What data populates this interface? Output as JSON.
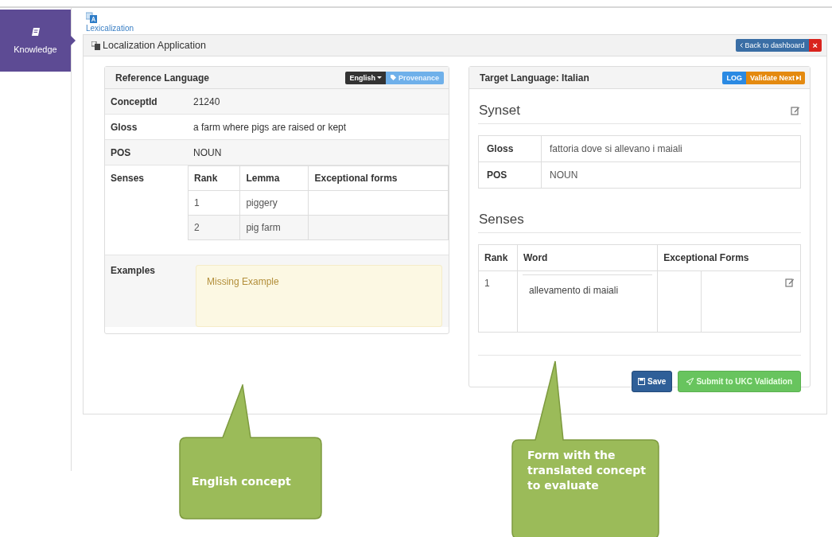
{
  "sidebar": {
    "items": [
      {
        "label": "Knowledge",
        "selected": true
      }
    ]
  },
  "app": {
    "label": "Lexicalization"
  },
  "panel": {
    "title": "Localization Application",
    "back_button": "Back to dashboard",
    "close_button": "×"
  },
  "reference": {
    "title": "Reference Language",
    "language_button": "English",
    "provenance_button": "Provenance",
    "fields": [
      {
        "label": "ConceptId",
        "value": "21240"
      },
      {
        "label": "Gloss",
        "value": "a farm where pigs are raised or kept"
      },
      {
        "label": "POS",
        "value": "NOUN"
      }
    ],
    "senses": {
      "label": "Senses",
      "columns": [
        "Rank",
        "Lemma",
        "Exceptional forms"
      ],
      "rows": [
        [
          "1",
          "piggery",
          ""
        ],
        [
          "2",
          "pig farm",
          ""
        ]
      ]
    },
    "examples": {
      "label": "Examples",
      "message": "Missing Example"
    }
  },
  "target": {
    "title": "Target Language: Italian",
    "log_button": "LOG",
    "validate_button": "Validate Next",
    "synset_heading": "Synset",
    "fields": [
      {
        "label": "Gloss",
        "value": "fattoria dove si allevano i maiali"
      },
      {
        "label": "POS",
        "value": "NOUN"
      }
    ],
    "senses_heading": "Senses",
    "senses": {
      "columns": [
        "Rank",
        "Word",
        "Exceptional Forms"
      ],
      "rows": [
        {
          "rank": "1",
          "word": "allevamento di maiali"
        }
      ]
    },
    "save_button": "Save",
    "submit_button": "Submit to UKC Validation"
  },
  "annotations": [
    {
      "text": "English concept"
    },
    {
      "text": "Form with the translated concept to evaluate"
    }
  ]
}
